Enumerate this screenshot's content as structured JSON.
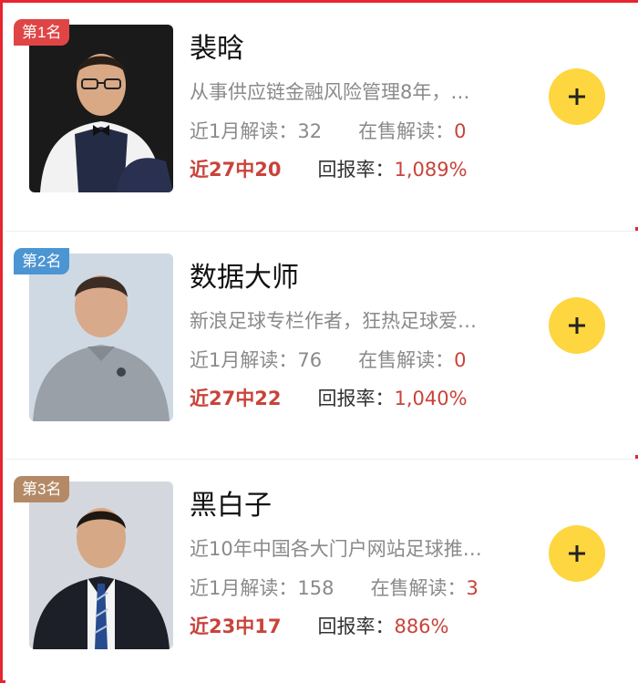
{
  "experts": [
    {
      "rank_label": "第1名",
      "name": "裴晗",
      "description": "从事供应链金融风险管理8年，…",
      "month_reads_label": "近1月解读：",
      "month_reads_value": "32",
      "on_sale_label": "在售解读：",
      "on_sale_value": "0",
      "streak": "近27中20",
      "return_label": "回报率：",
      "return_value": "1,089%",
      "follow_icon": "plus-icon"
    },
    {
      "rank_label": "第2名",
      "name": "数据大师",
      "description": "新浪足球专栏作者，狂热足球爱…",
      "month_reads_label": "近1月解读：",
      "month_reads_value": "76",
      "on_sale_label": "在售解读：",
      "on_sale_value": "0",
      "streak": "近27中22",
      "return_label": "回报率：",
      "return_value": "1,040%",
      "follow_icon": "plus-icon"
    },
    {
      "rank_label": "第3名",
      "name": "黑白子",
      "description": "近10年中国各大门户网站足球推…",
      "month_reads_label": "近1月解读：",
      "month_reads_value": "158",
      "on_sale_label": "在售解读：",
      "on_sale_value": "3",
      "streak": "近23中17",
      "return_label": "回报率：",
      "return_value": "886%",
      "follow_icon": "plus-icon"
    }
  ],
  "colors": {
    "frame": "#e8252f",
    "accent_red": "#c9433a",
    "follow_yellow": "#fdd640",
    "rank_1": "#e04545",
    "rank_2": "#4c95d3",
    "rank_3": "#b48a66"
  }
}
